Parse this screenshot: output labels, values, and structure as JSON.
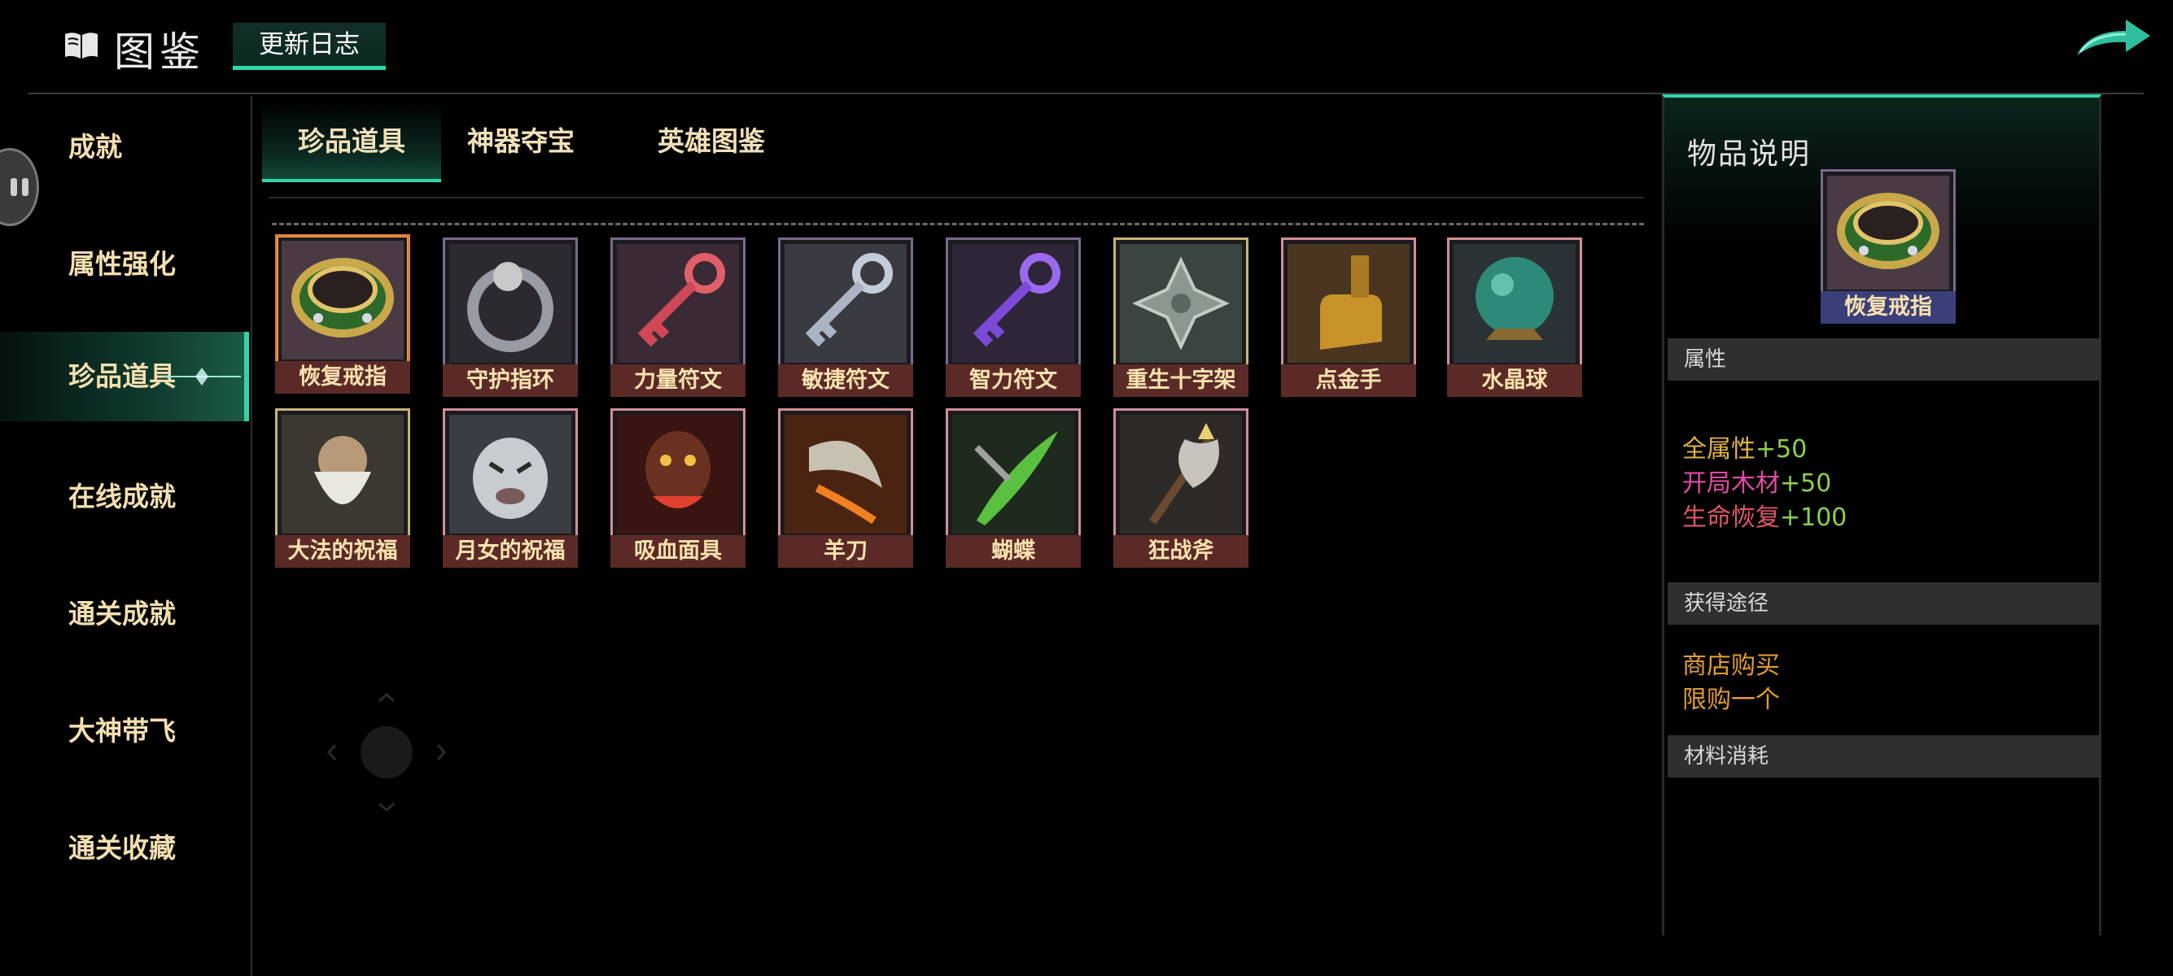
{
  "header": {
    "title": "图鉴",
    "changelog_label": "更新日志"
  },
  "leftnav": {
    "items": [
      {
        "label": "成就"
      },
      {
        "label": "属性强化"
      },
      {
        "label": "珍品道具"
      },
      {
        "label": "在线成就"
      },
      {
        "label": "通关成就"
      },
      {
        "label": "大神带飞"
      },
      {
        "label": "通关收藏"
      }
    ],
    "active_index": 2
  },
  "tabs": [
    {
      "label": "珍品道具"
    },
    {
      "label": "神器夺宝"
    },
    {
      "label": "英雄图鉴"
    }
  ],
  "items": [
    {
      "name": "恢复戒指"
    },
    {
      "name": "守护指环"
    },
    {
      "name": "力量符文"
    },
    {
      "name": "敏捷符文"
    },
    {
      "name": "智力符文"
    },
    {
      "name": "重生十字架"
    },
    {
      "name": "点金手"
    },
    {
      "name": "水晶球"
    },
    {
      "name": "大法的祝福"
    },
    {
      "name": "月女的祝福"
    },
    {
      "name": "吸血面具"
    },
    {
      "name": "羊刀"
    },
    {
      "name": "蝴蝶"
    },
    {
      "name": "狂战斧"
    }
  ],
  "detail": {
    "title": "物品说明",
    "item_name": "恢复戒指",
    "attr_header": "属性",
    "attributes": [
      {
        "name": "全属性",
        "value": "+50"
      },
      {
        "name": "开局木材",
        "value": "+50"
      },
      {
        "name": "生命恢复",
        "value": "+100"
      }
    ],
    "source_header": "获得途径",
    "sources": [
      "商店购买",
      "限购一个"
    ],
    "material_header": "材料消耗"
  },
  "colors": {
    "accent": "#2fd6a6",
    "selected_border": "#e08232",
    "label_bg": "#5c2a26"
  }
}
